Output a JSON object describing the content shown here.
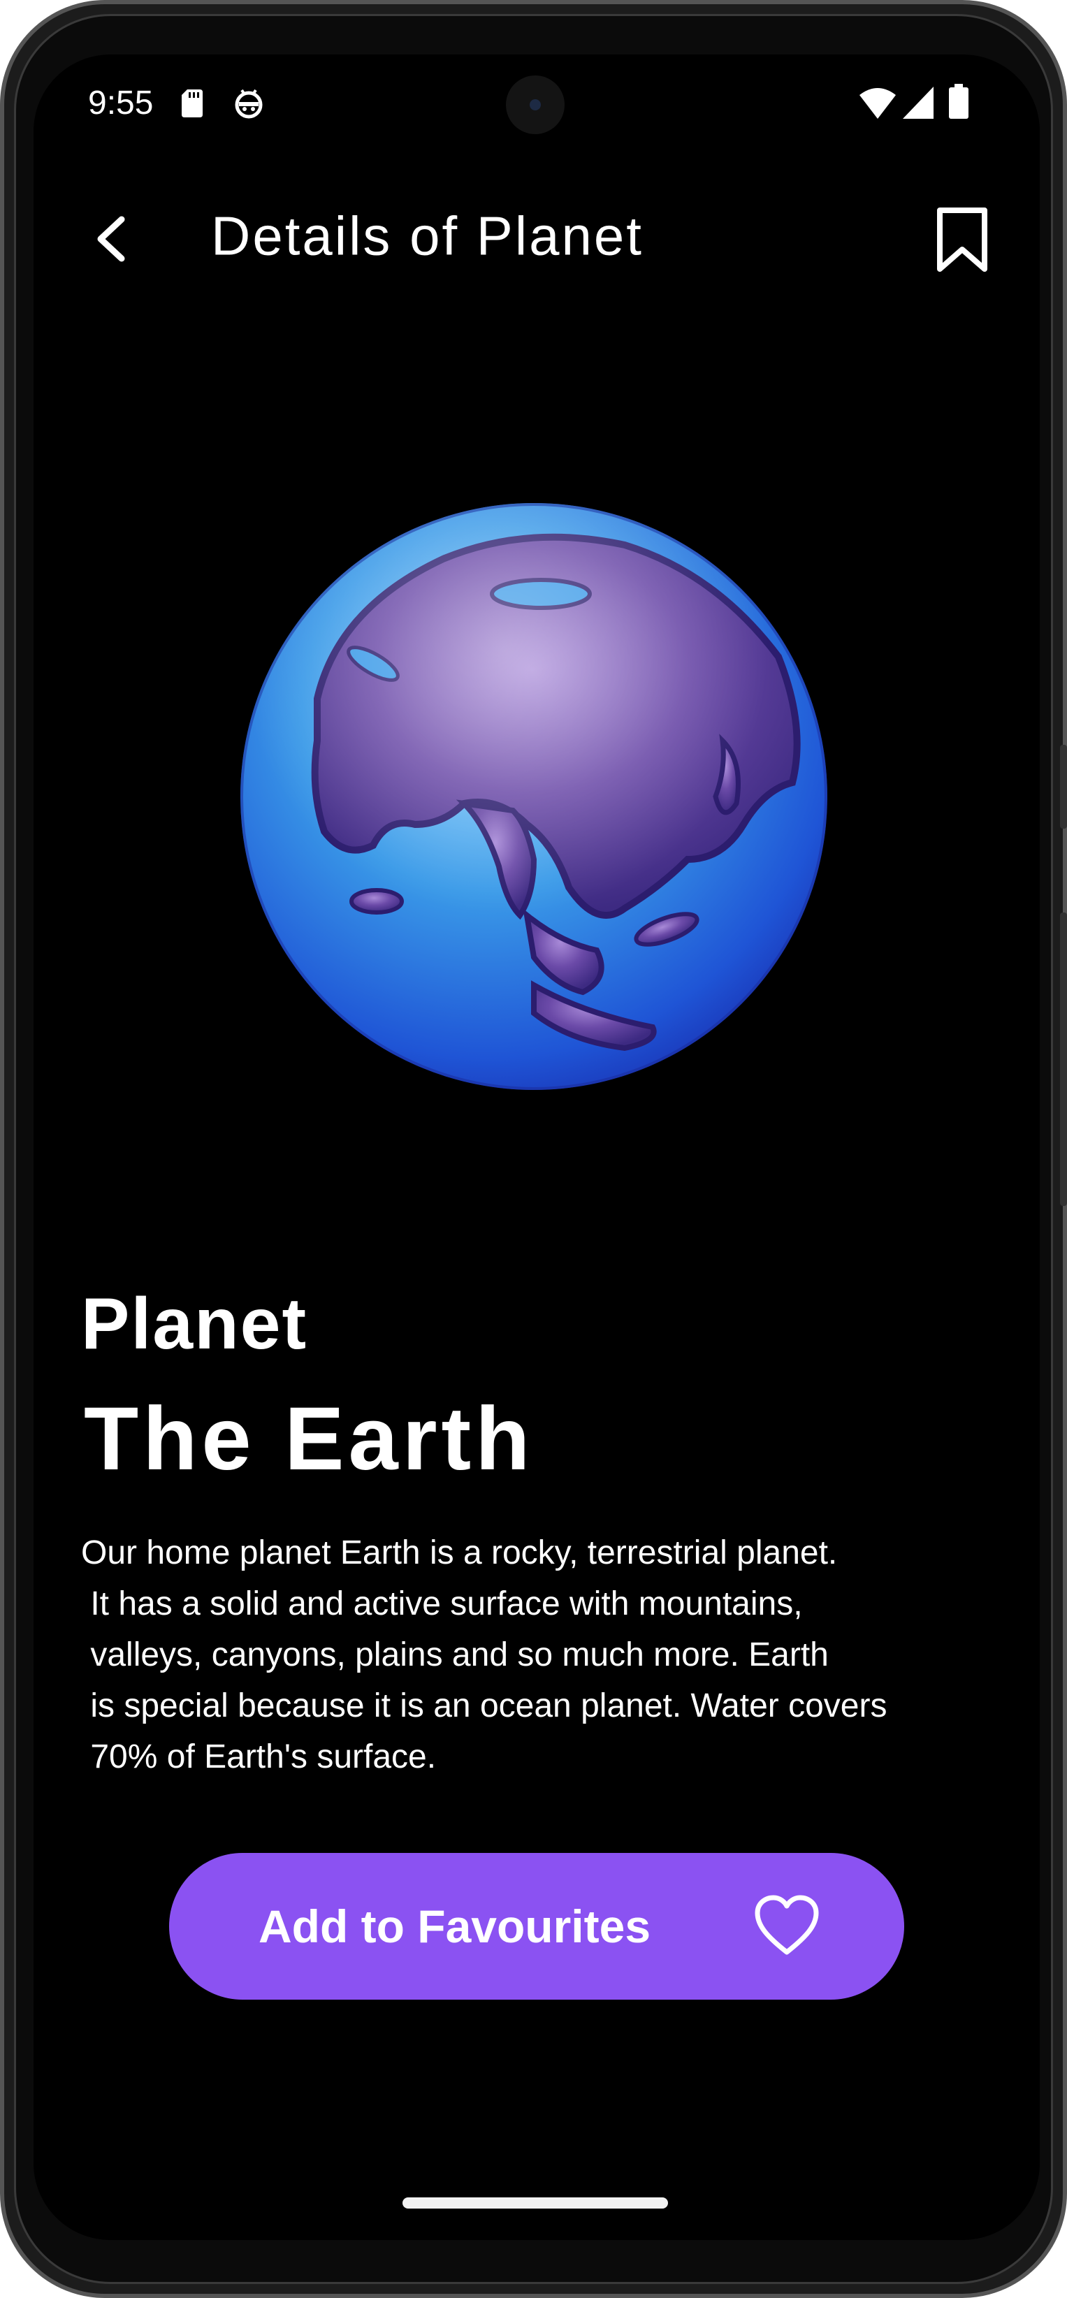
{
  "status_bar": {
    "time": "9:55",
    "icons": [
      "sd-card-icon",
      "android-debug-icon",
      "wifi-icon",
      "signal-icon",
      "battery-icon"
    ]
  },
  "app_bar": {
    "title": "Details of Planet",
    "back_icon": "chevron-left-icon",
    "bookmark_icon": "bookmark-outline-icon"
  },
  "planet": {
    "image": "earth-globe-image",
    "overline": "Planet",
    "name": "The Earth",
    "description_lines": [
      "Our home planet Earth is a rocky, terrestrial planet.",
      " It has a solid and active surface with mountains,",
      " valleys, canyons, plains and so much more. Earth",
      " is special because it is an ocean planet. Water covers",
      " 70% of Earth's surface."
    ]
  },
  "favourite_button": {
    "label": "Add to Favourites",
    "icon": "heart-outline-icon",
    "color": "#8b52f2"
  },
  "colors": {
    "background": "#000000",
    "text": "#ffffff",
    "accent": "#8b52f2"
  }
}
